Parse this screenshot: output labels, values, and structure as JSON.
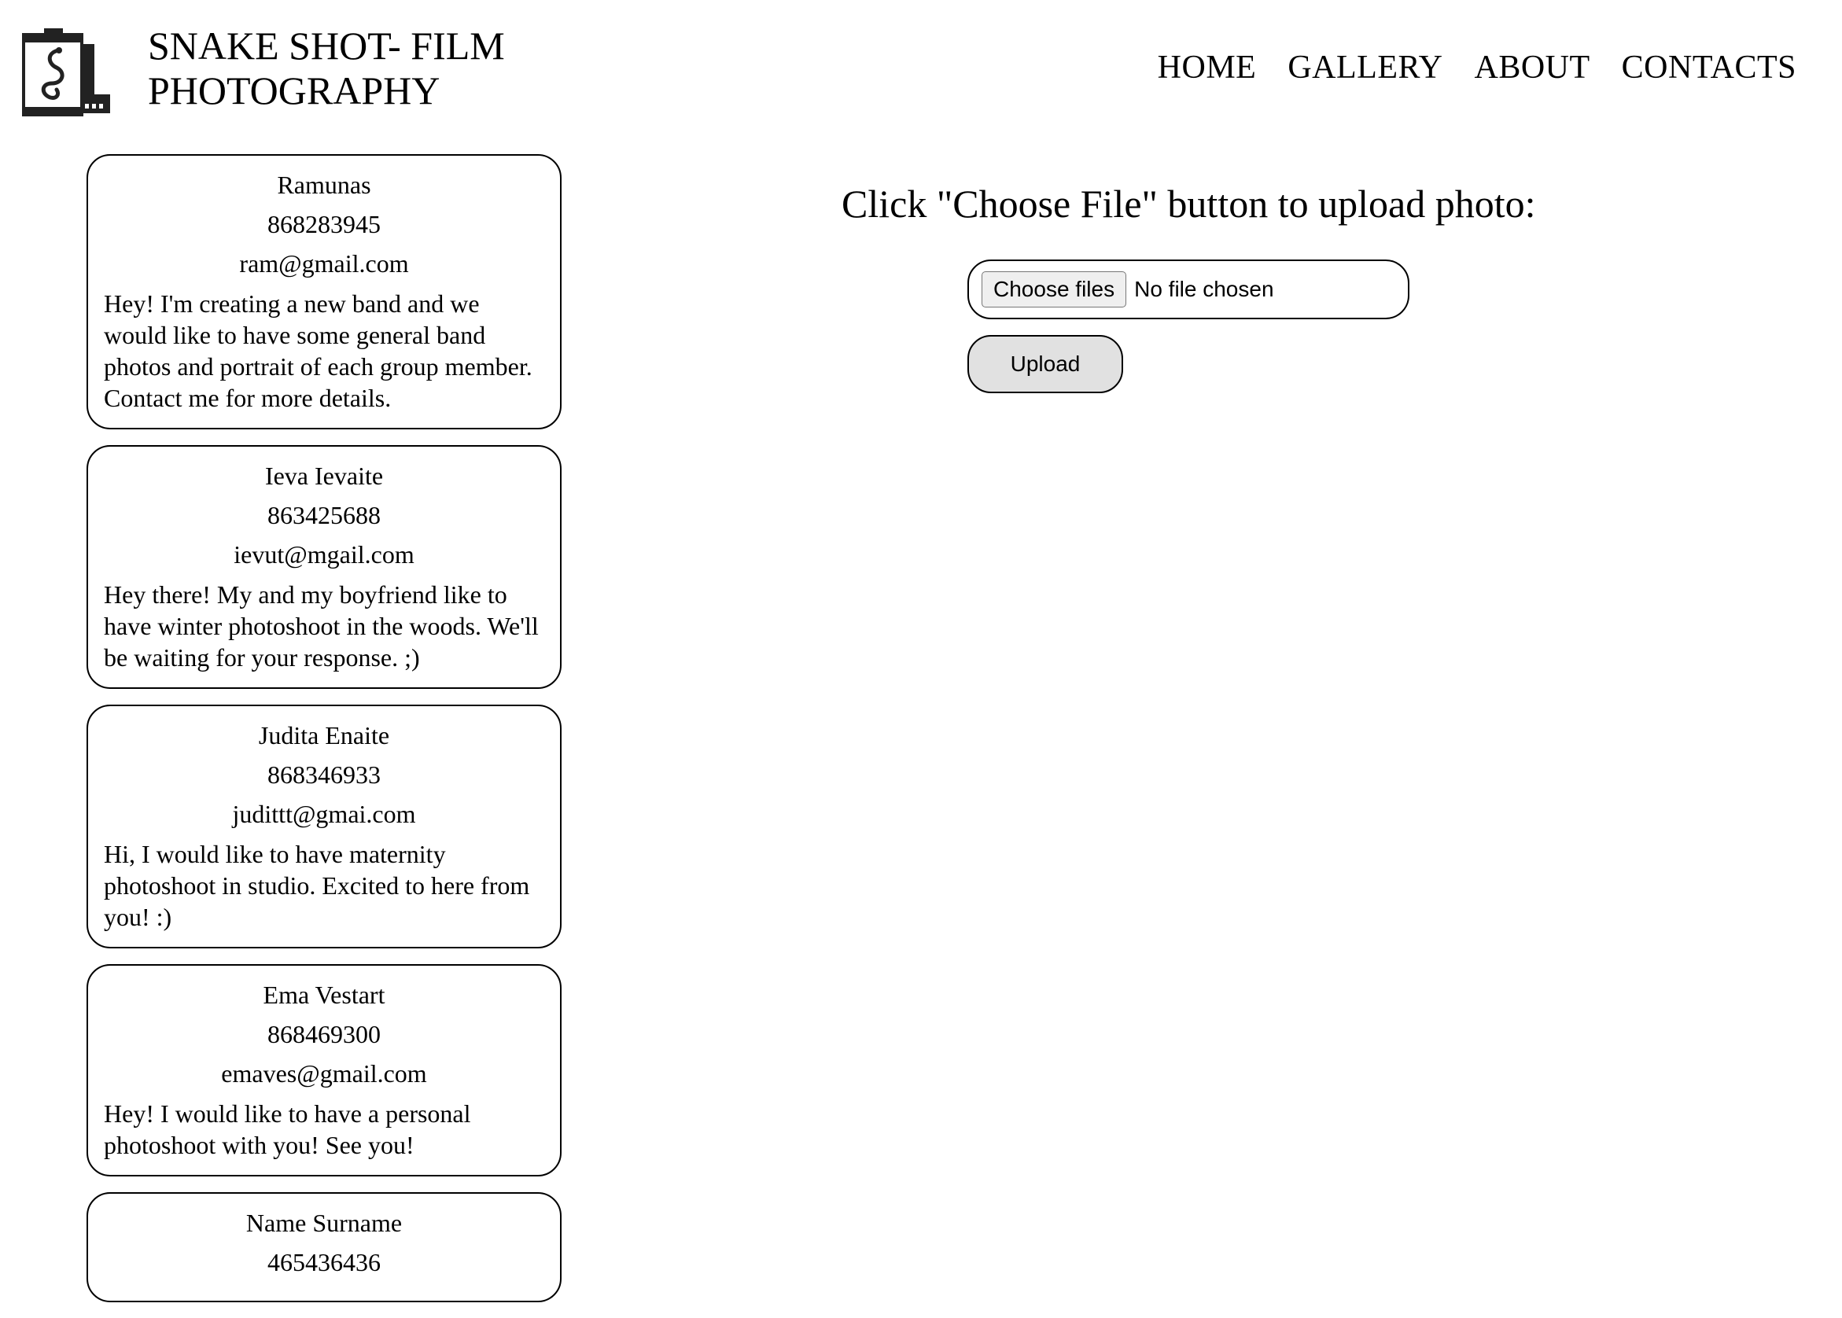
{
  "header": {
    "logo_icon": "film-canister-snake-icon",
    "title": "SNAKE SHOT- FILM PHOTOGRAPHY"
  },
  "nav": {
    "items": [
      "HOME",
      "GALLERY",
      "ABOUT",
      "CONTACTS"
    ]
  },
  "messages": [
    {
      "name": "Ramunas",
      "phone": "868283945",
      "email": "ram@gmail.com",
      "message": "Hey! I'm creating a new band and we would like to have some general band photos and portrait of each group member. Contact me for more details."
    },
    {
      "name": "Ieva Ievaite",
      "phone": "863425688",
      "email": "ievut@mgail.com",
      "message": "Hey there! My and my boyfriend like to have winter photoshoot in the woods. We'll be waiting for your response. ;)"
    },
    {
      "name": "Judita Enaite",
      "phone": "868346933",
      "email": "judittt@gmai.com",
      "message": "Hi, I would like to have maternity photoshoot in studio. Excited to here from you! :)"
    },
    {
      "name": "Ema Vestart",
      "phone": "868469300",
      "email": "emaves@gmail.com",
      "message": "Hey! I would like to have a personal photoshoot with you! See you!"
    },
    {
      "name": "Name Surname",
      "phone": "465436436",
      "email": "",
      "message": ""
    }
  ],
  "upload": {
    "title": "Click \"Choose File\" button to upload photo:",
    "choose_label": "Choose files",
    "status": "No file chosen",
    "upload_label": "Upload"
  }
}
